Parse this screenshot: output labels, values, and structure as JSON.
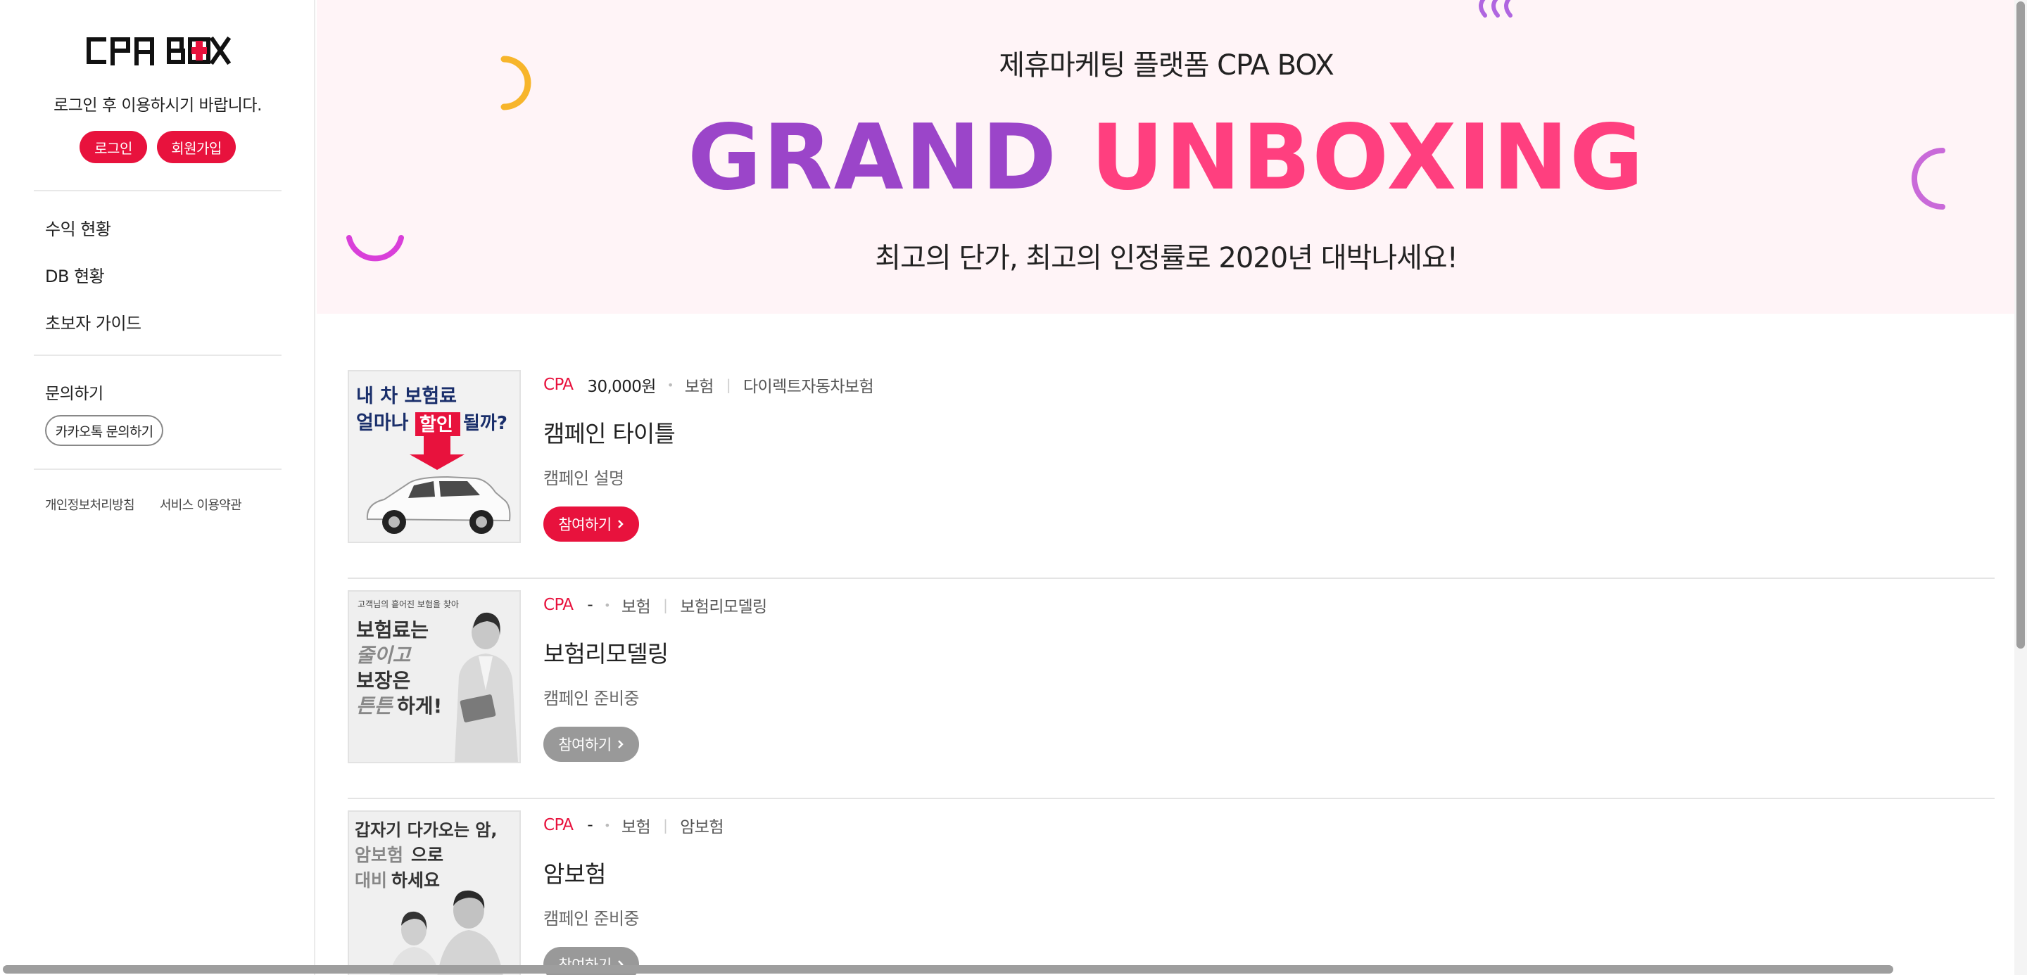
{
  "sidebar": {
    "logo_text": "CPA BOX",
    "login_message": "로그인 후 이용하시기 바랍니다.",
    "login_label": "로그인",
    "join_label": "회원가입",
    "nav": [
      {
        "label": "수익 현황"
      },
      {
        "label": "DB 현황"
      },
      {
        "label": "초보자 가이드"
      }
    ],
    "inquiry_title": "문의하기",
    "kakao_label": "카카오톡 문의하기",
    "footer": {
      "privacy": "개인정보처리방침",
      "terms": "서비스 이용약관"
    }
  },
  "banner": {
    "subtitle": "제휴마케팅 플랫폼 CPA BOX",
    "title_part1": "GRAND",
    "title_part2": "UNBOXING",
    "description": "최고의 단가, 최고의 인정률로 2020년 대박나세요!"
  },
  "campaigns": [
    {
      "type": "CPA",
      "price": "30,000원",
      "category": "보험",
      "subcategory": "다이렉트자동차보험",
      "title": "캠페인 타이틀",
      "description": "캠페인 설명",
      "button": "참여하기",
      "active": true,
      "thumb_text": [
        "내 차 보험료",
        "얼마나",
        "할인",
        "될까?"
      ]
    },
    {
      "type": "CPA",
      "price": "-",
      "category": "보험",
      "subcategory": "보험리모델링",
      "title": "보험리모델링",
      "description": "캠페인 준비중",
      "button": "참여하기",
      "active": false,
      "thumb_text": [
        "고객님의 흩어진 보험을 찾아",
        "보험료는",
        "줄이고",
        "보장은",
        "튼튼",
        "하게!"
      ]
    },
    {
      "type": "CPA",
      "price": "-",
      "category": "보험",
      "subcategory": "암보험",
      "title": "암보험",
      "description": "캠페인 준비중",
      "button": "참여하기",
      "active": false,
      "thumb_text": [
        "갑자기 다가오는 암,",
        "암보험",
        "으로",
        "대비",
        "하세요"
      ]
    }
  ],
  "colors": {
    "accent": "#e8123d",
    "banner_bg": "#fff4f7",
    "grand": "#9b45c9",
    "unboxing": "#ff3f7f",
    "disabled": "#999999"
  }
}
